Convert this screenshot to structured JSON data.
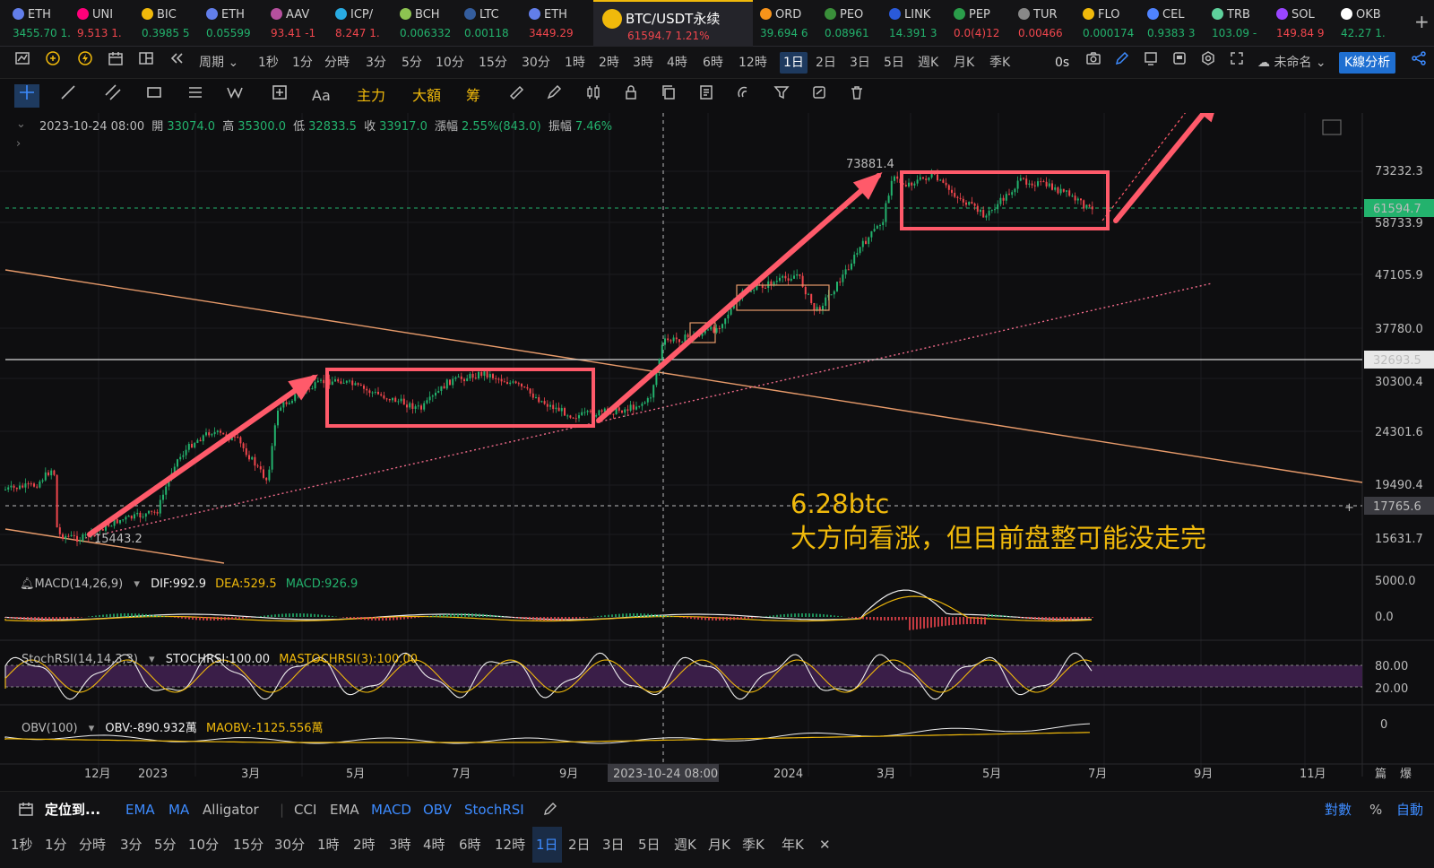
{
  "tickers": [
    {
      "sym": "ETH",
      "price": "3455.70",
      "chg": "1.",
      "dir": "up",
      "icon": "#627eea"
    },
    {
      "sym": "UNI",
      "price": "9.513",
      "chg": "1.",
      "dir": "dn",
      "icon": "#ff007a"
    },
    {
      "sym": "BIC",
      "price": "0.3985",
      "chg": "5",
      "dir": "up",
      "icon": "#f0b90b"
    },
    {
      "sym": "ETH",
      "price": "0.05599",
      "chg": "",
      "dir": "up",
      "icon": "#627eea"
    },
    {
      "sym": "AAV",
      "price": "93.41",
      "chg": "-1",
      "dir": "dn",
      "icon": "#b6509e"
    },
    {
      "sym": "ICP/",
      "price": "8.247",
      "chg": "1.",
      "dir": "dn",
      "icon": "#29abe2"
    },
    {
      "sym": "BCH",
      "price": "0.006332",
      "chg": "",
      "dir": "up",
      "icon": "#8dc351"
    },
    {
      "sym": "LTC",
      "price": "0.00118",
      "chg": "",
      "dir": "up",
      "icon": "#345d9d"
    },
    {
      "sym": "ETH",
      "price": "3449.29",
      "chg": "",
      "dir": "dn",
      "icon": "#627eea"
    },
    {
      "sym": "ORD",
      "price": "39.694",
      "chg": "6",
      "dir": "up",
      "icon": "#f7931a"
    },
    {
      "sym": "PEO",
      "price": "0.08961",
      "chg": "",
      "dir": "up",
      "icon": "#3a8f3a"
    },
    {
      "sym": "LINK",
      "price": "14.391",
      "chg": "3",
      "dir": "up",
      "icon": "#2a5ada"
    },
    {
      "sym": "PEP",
      "price": "0.0(4)12",
      "chg": "",
      "dir": "dn",
      "icon": "#2a9d4a"
    },
    {
      "sym": "TUR",
      "price": "0.00466",
      "chg": "",
      "dir": "dn",
      "icon": "#888"
    },
    {
      "sym": "FLO",
      "price": "0.000174",
      "chg": "",
      "dir": "up",
      "icon": "#f0b90b"
    },
    {
      "sym": "CEL",
      "price": "0.9383",
      "chg": "3",
      "dir": "up",
      "icon": "#4f83ff"
    },
    {
      "sym": "TRB",
      "price": "103.09",
      "chg": "-",
      "dir": "up",
      "icon": "#5ed19c"
    },
    {
      "sym": "SOL",
      "price": "149.84",
      "chg": "9",
      "dir": "dn",
      "icon": "#9945ff"
    },
    {
      "sym": "OKB",
      "price": "42.27",
      "chg": "1.",
      "dir": "up",
      "icon": "#ffffff"
    }
  ],
  "active_ticker": {
    "sym": "BTC/USDT永续",
    "price": "61594.7",
    "chg": "1.21%"
  },
  "add_tab": "+",
  "toolbar1": {
    "period_label": "周期",
    "timeframes": [
      "1秒",
      "1分",
      "分時",
      "3分",
      "5分",
      "10分",
      "15分",
      "30分",
      "1時",
      "2時",
      "3時",
      "4時",
      "6時",
      "12時",
      "1日",
      "2日",
      "3日",
      "5日",
      "週K",
      "月K",
      "季K"
    ],
    "selected_tf": "1日",
    "countdown": "0s",
    "layout_name": "未命名",
    "analysis_button": "K線分析"
  },
  "toolbar2": {
    "main": "主力",
    "big": "大額",
    "chips": "筹",
    "aa": "Aa"
  },
  "ohlc": {
    "date": "2023-10-24 08:00",
    "open_label": "開",
    "open": "33074.0",
    "high_label": "高",
    "high": "35300.0",
    "low_label": "低",
    "low": "32833.5",
    "close_label": "收",
    "close": "33917.0",
    "chg_label": "漲幅",
    "chg": "2.55%(843.0)",
    "amp_label": "振幅",
    "amp": "7.46%"
  },
  "price_axis": [
    "73232.3",
    "58733.9",
    "47105.9",
    "37780.0",
    "30300.4",
    "24301.6",
    "19490.4",
    "15631.7"
  ],
  "price_boxes": {
    "current": "61594.7",
    "hline": "32693.5",
    "cursor": "17765.6"
  },
  "chart_labels": {
    "high_marker": "73881.4",
    "low_marker": "15443.2"
  },
  "time_axis": [
    "12月",
    "2023",
    "3月",
    "5月",
    "7月",
    "9月",
    "2023-10-24 08:00",
    "2024",
    "3月",
    "5月",
    "7月",
    "9月",
    "11月"
  ],
  "axis_corner": [
    "篇",
    "爆"
  ],
  "annotation": {
    "line1": "6.28btc",
    "line2": "大方向看涨，但目前盘整可能没走完"
  },
  "macd": {
    "title": "MACD(14,26,9)",
    "dif": "DIF:992.9",
    "dea": "DEA:529.5",
    "macd": "MACD:926.9",
    "axis": [
      "5000.0",
      "0.0"
    ]
  },
  "stochrsi": {
    "title": "StochRSI(14,14,3,3)",
    "k": "STOCHRSI:100.00",
    "d": "MASTOCHRSI(3):100.00",
    "axis": [
      "80.00",
      "20.00"
    ]
  },
  "obv": {
    "title": "OBV(100)",
    "obv": "OBV:-890.932萬",
    "ma": "MAOBV:-1125.556萬",
    "axis": [
      "0"
    ]
  },
  "bottom1": {
    "locate": "定位到...",
    "ind_main": [
      "EMA",
      "MA",
      "Alligator"
    ],
    "ind_sub": [
      "CCI",
      "EMA",
      "MACD",
      "OBV",
      "StochRSI"
    ],
    "log": "對數",
    "pct": "%",
    "auto": "自動"
  },
  "bottom2": {
    "timeframes": [
      "1秒",
      "1分",
      "分時",
      "3分",
      "5分",
      "10分",
      "15分",
      "30分",
      "1時",
      "2時",
      "3時",
      "4時",
      "6時",
      "12時",
      "1日",
      "2日",
      "3日",
      "5日",
      "週K",
      "月K",
      "季K",
      "年K"
    ],
    "selected": "1日",
    "close": "✕"
  },
  "colors": {
    "up": "#23b26d",
    "down": "#f0464d",
    "accent": "#f0b90b",
    "box": "#ff5a6a",
    "trend": "#e69a6a"
  }
}
